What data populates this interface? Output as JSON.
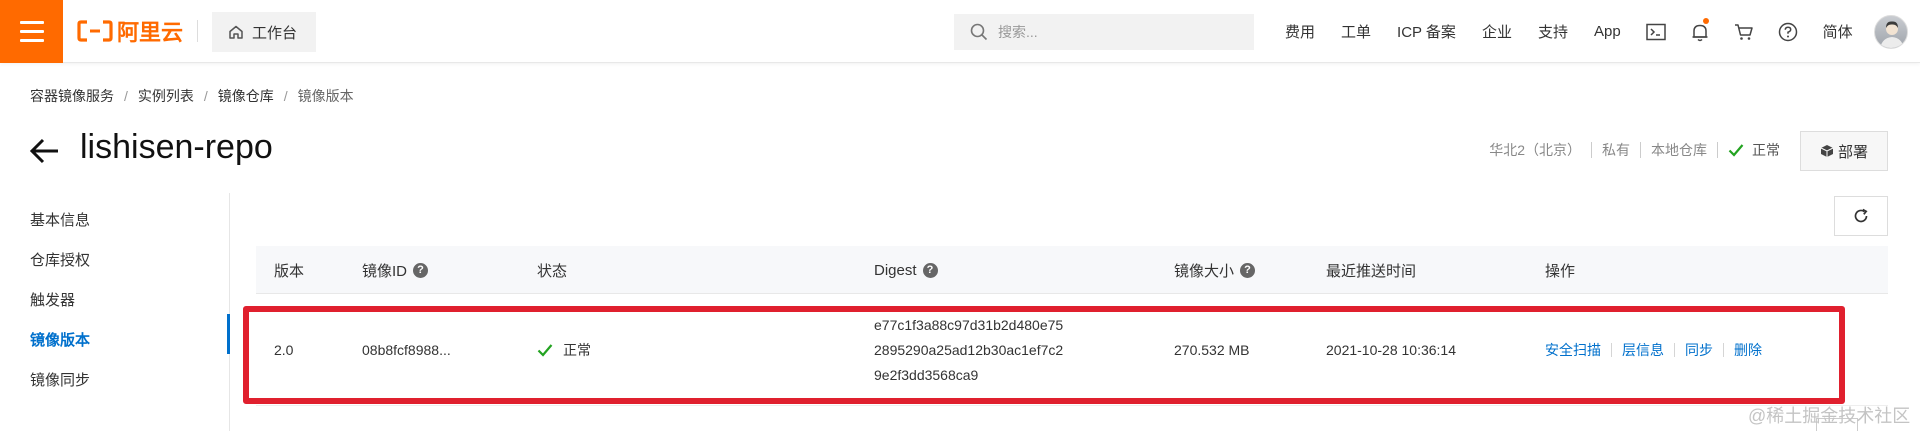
{
  "topbar": {
    "logo_text": "阿里云",
    "workbench_label": "工作台",
    "search_placeholder": "搜索...",
    "nav": [
      "费用",
      "工单",
      "ICP 备案",
      "企业",
      "支持",
      "App"
    ],
    "lang": "简体",
    "icons": [
      "terminal-icon",
      "bell-icon",
      "cart-icon",
      "help-icon"
    ],
    "accent_color": "#ff6a00"
  },
  "breadcrumb": [
    "容器镜像服务",
    "实例列表",
    "镜像仓库",
    "镜像版本"
  ],
  "header": {
    "title": "lishisen-repo",
    "region": "华北2（北京）",
    "visibility": "私有",
    "repo_type": "本地仓库",
    "status": "正常",
    "deploy_label": "部署"
  },
  "sidemenu": {
    "items": [
      "基本信息",
      "仓库授权",
      "触发器",
      "镜像版本",
      "镜像同步"
    ],
    "active": "镜像版本",
    "active_color": "#0070cc"
  },
  "table": {
    "columns": [
      "版本",
      "镜像ID",
      "状态",
      "Digest",
      "镜像大小",
      "最近推送时间",
      "操作"
    ],
    "rows": [
      {
        "version": "2.0",
        "image_id": "08b8fcf8988...",
        "status": "正常",
        "digest_lines": [
          "e77c1f3a88c97d31b2d480e75",
          "2895290a25ad12b30ac1ef7c2",
          "9e2f3dd3568ca9"
        ],
        "size": "270.532 MB",
        "pushed_at": "2021-10-28 10:36:14",
        "actions": [
          "安全扫描",
          "层信息",
          "同步",
          "删除"
        ]
      }
    ]
  },
  "annotation_color": "#e0202e",
  "watermark": "@稀土掘金技术社区"
}
